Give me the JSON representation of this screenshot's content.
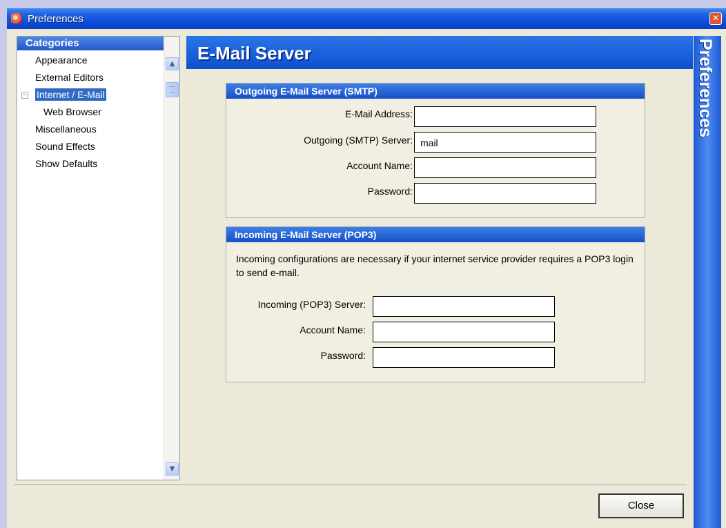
{
  "window": {
    "title": "Preferences"
  },
  "sidebar": {
    "header": "Categories",
    "items": [
      {
        "label": "Appearance",
        "level": 0,
        "selected": false
      },
      {
        "label": "External Editors",
        "level": 0,
        "selected": false
      },
      {
        "label": "Internet / E-Mail",
        "level": 0,
        "selected": true,
        "expanded": true
      },
      {
        "label": "Web Browser",
        "level": 1,
        "selected": false
      },
      {
        "label": "Miscellaneous",
        "level": 0,
        "selected": false
      },
      {
        "label": "Sound Effects",
        "level": 0,
        "selected": false
      },
      {
        "label": "Show Defaults",
        "level": 0,
        "selected": false
      }
    ]
  },
  "main": {
    "title": "E-Mail Server",
    "side_label": "Preferences",
    "outgoing": {
      "header": "Outgoing E-Mail Server (SMTP)",
      "email_label": "E-Mail Address:",
      "email_value": "",
      "server_label": "Outgoing (SMTP) Server:",
      "server_value": "mail",
      "account_label": "Account Name:",
      "account_value": "",
      "password_label": "Password:",
      "password_value": ""
    },
    "incoming": {
      "header": "Incoming E-Mail Server (POP3)",
      "description": "Incoming configurations are necessary if your internet service provider requires a POP3 login to send e-mail.",
      "server_label": "Incoming (POP3) Server:",
      "server_value": "",
      "account_label": "Account Name:",
      "account_value": "",
      "password_label": "Password:",
      "password_value": ""
    }
  },
  "footer": {
    "close_label": "Close"
  }
}
